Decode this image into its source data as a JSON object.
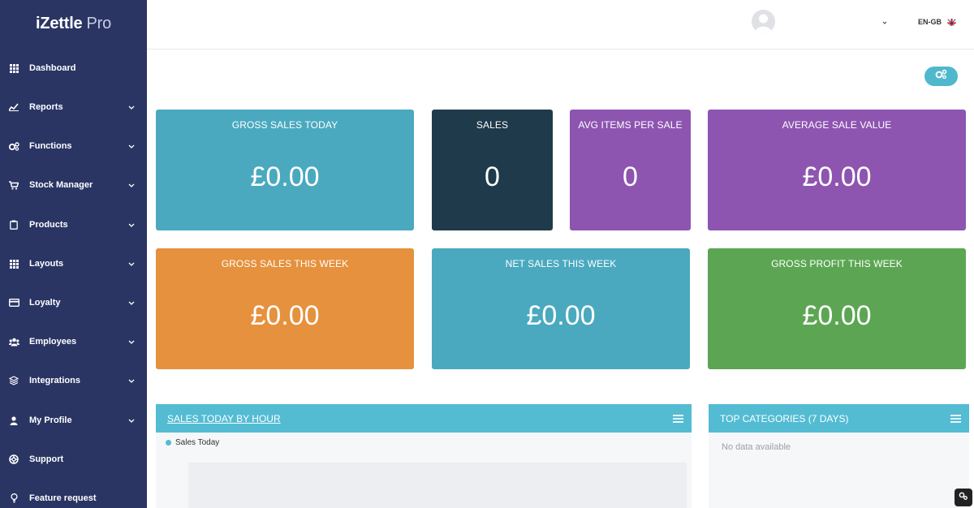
{
  "brand": {
    "name": "iZettle",
    "suffix": "Pro"
  },
  "sidebar": {
    "items": [
      {
        "label": "Dashboard",
        "icon": "grid-icon",
        "has_chevron": false
      },
      {
        "label": "Reports",
        "icon": "chart-line-icon",
        "has_chevron": true
      },
      {
        "label": "Functions",
        "icon": "cogs-icon",
        "has_chevron": true
      },
      {
        "label": "Stock Manager",
        "icon": "cart-icon",
        "has_chevron": true
      },
      {
        "label": "Products",
        "icon": "clipboard-icon",
        "has_chevron": true
      },
      {
        "label": "Layouts",
        "icon": "grid-icon",
        "has_chevron": true
      },
      {
        "label": "Loyalty",
        "icon": "credit-card-icon",
        "has_chevron": true
      },
      {
        "label": "Employees",
        "icon": "users-icon",
        "has_chevron": true
      },
      {
        "label": "Integrations",
        "icon": "layers-icon",
        "has_chevron": true
      },
      {
        "label": "My Profile",
        "icon": "user-icon",
        "has_chevron": true
      },
      {
        "label": "Support",
        "icon": "lifebuoy-icon",
        "has_chevron": false
      },
      {
        "label": "Feature request",
        "icon": "lightbulb-icon",
        "has_chevron": false
      }
    ]
  },
  "header": {
    "language": "EN-GB"
  },
  "stats": [
    {
      "title": "GROSS SALES TODAY",
      "value": "£0.00",
      "color": "#4aa9bf"
    },
    {
      "title": "SALES",
      "value": "0",
      "color": "#1f3a4a"
    },
    {
      "title": "AVG ITEMS PER SALE",
      "value": "0",
      "color": "#8d55b0"
    },
    {
      "title": "AVERAGE SALE VALUE",
      "value": "£0.00",
      "color": "#8d55b0"
    },
    {
      "title": "GROSS SALES THIS WEEK",
      "value": "£0.00",
      "color": "#e6913e"
    },
    {
      "title": "NET SALES THIS WEEK",
      "value": "£0.00",
      "color": "#4aa9bf"
    },
    {
      "title": "GROSS PROFIT THIS WEEK",
      "value": "£0.00",
      "color": "#5ca653"
    }
  ],
  "panels": {
    "sales_today": {
      "title": "SALES TODAY BY HOUR",
      "legend": "Sales Today"
    },
    "top_categories": {
      "title": "TOP CATEGORIES (7 DAYS)",
      "empty_text": "No data available"
    }
  },
  "colors": {
    "sidebar": "#2a3564",
    "accent": "#53bcd3"
  }
}
